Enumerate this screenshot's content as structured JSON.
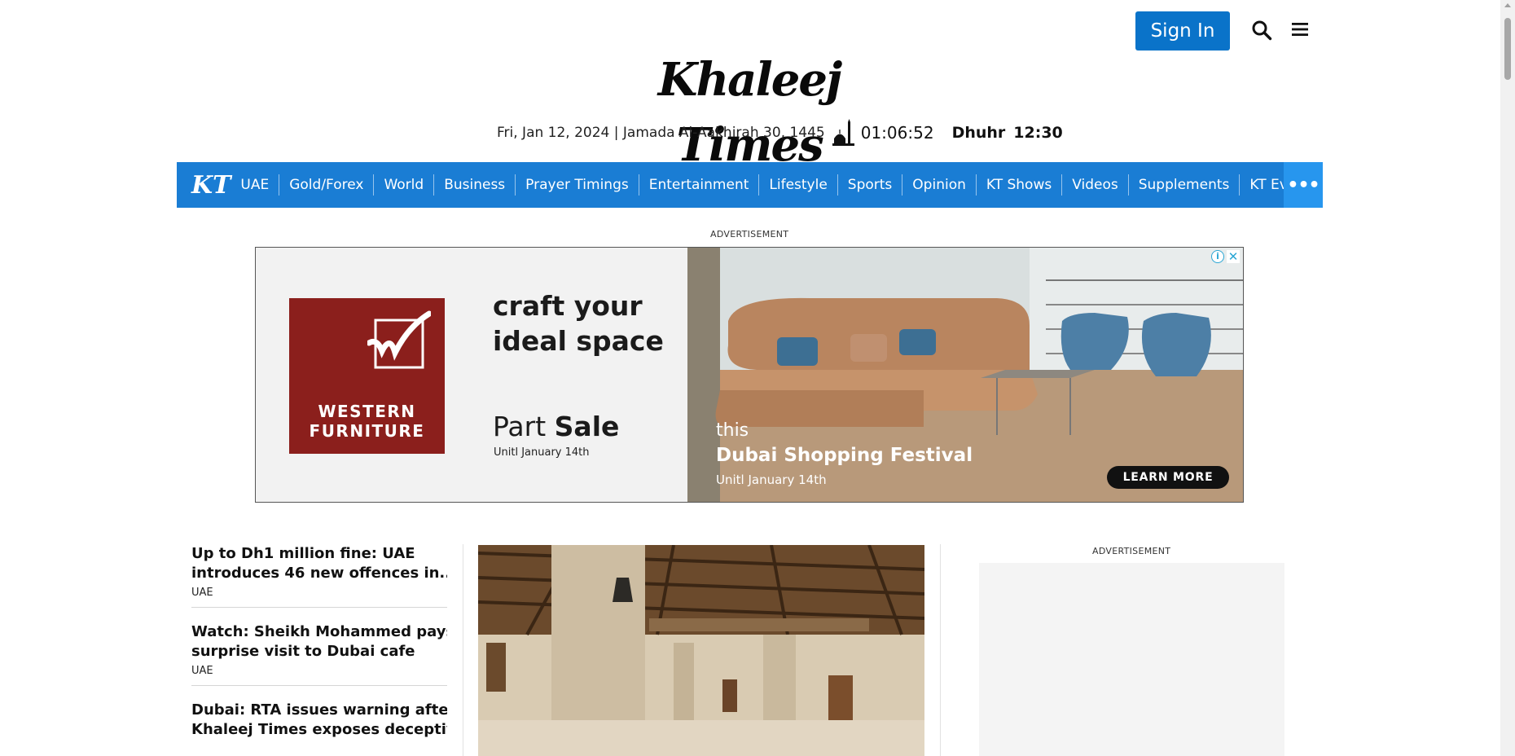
{
  "header": {
    "signin_label": "Sign In",
    "logo_text": "Khaleej Times",
    "date_text": "Fri, Jan 12, 2024 | Jamada Al-Aakhirah 30, 1445",
    "clock": "01:06:52",
    "prayer_name": "Dhuhr",
    "prayer_time": "12:30"
  },
  "nav": {
    "logo": "KT",
    "items": [
      "UAE",
      "Gold/Forex",
      "World",
      "Business",
      "Prayer Timings",
      "Entertainment",
      "Lifestyle",
      "Sports",
      "Opinion",
      "KT Shows",
      "Videos",
      "Supplements",
      "KT Events"
    ],
    "more": "•••"
  },
  "ads": {
    "top_label": "ADVERTISEMENT",
    "side_label": "ADVERTISEMENT",
    "banner": {
      "brand": "WESTERN FURNITURE",
      "headline": "craft your ideal space",
      "sale_prefix": "Part",
      "sale_bold": "Sale",
      "until_left": "Unitl January 14th",
      "this": "this",
      "festival": "Dubai Shopping Festival",
      "until_right": "Unitl January 14th",
      "cta": "LEARN MORE"
    }
  },
  "news": [
    {
      "title_line1": "Up to Dh1 million fine: UAE",
      "title_line2": "introduces 46 new offences in...",
      "category": "UAE"
    },
    {
      "title_line1": "Watch: Sheikh Mohammed pays",
      "title_line2": "surprise visit to Dubai cafe",
      "category": "UAE"
    },
    {
      "title_line1": "Dubai: RTA issues warning after",
      "title_line2": "Khaleej Times exposes deceptiv...",
      "category": ""
    }
  ],
  "colors": {
    "brand_blue": "#1a7dd4",
    "signin_blue": "#0a73c9",
    "wf_red": "#8b1f1c"
  }
}
